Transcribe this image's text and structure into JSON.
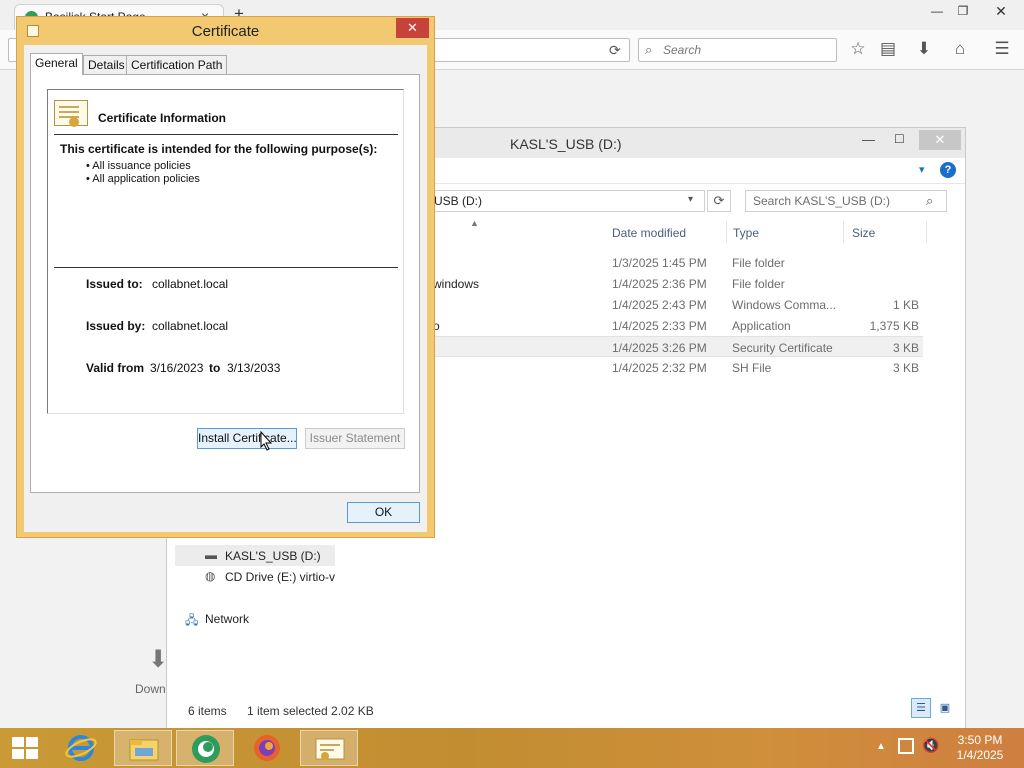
{
  "browser": {
    "tab_title": "Basilisk Start Page",
    "tab_close": "×",
    "new_tab": "+",
    "search_placeholder": "Search",
    "download_label": "Down"
  },
  "explorer": {
    "title": "KASL'S_USB (D:)",
    "address": "USB (D:)",
    "search_placeholder": "Search KASL'S_USB (D:)",
    "columns": {
      "date": "Date modified",
      "type": "Type",
      "size": "Size"
    },
    "files": [
      {
        "name": "",
        "date": "1/3/2025 1:45 PM",
        "type": "File folder",
        "size": ""
      },
      {
        "name": "windows",
        "date": "1/4/2025 2:36 PM",
        "type": "File folder",
        "size": ""
      },
      {
        "name": "",
        "date": "1/4/2025 2:43 PM",
        "type": "Windows Comma...",
        "size": "1 KB"
      },
      {
        "name": "o",
        "date": "1/4/2025 2:33 PM",
        "type": "Application",
        "size": "1,375 KB"
      },
      {
        "name": "",
        "date": "1/4/2025 3:26 PM",
        "type": "Security Certificate",
        "size": "3 KB"
      },
      {
        "name": "",
        "date": "1/4/2025 2:32 PM",
        "type": "SH File",
        "size": "3 KB"
      }
    ],
    "nav": {
      "usb": "KASL'S_USB (D:)",
      "cd": "CD Drive (E:) virtio-v",
      "network": "Network"
    },
    "status": {
      "items": "6 items",
      "selected": "1 item selected  2.02 KB"
    }
  },
  "cert": {
    "title": "Certificate",
    "tabs": [
      "General",
      "Details",
      "Certification Path"
    ],
    "info_heading": "Certificate Information",
    "purpose_heading": "This certificate is intended for the following purpose(s):",
    "purposes": [
      "• All issuance policies",
      "• All application policies"
    ],
    "issued_to_label": "Issued to:",
    "issued_to": "collabnet.local",
    "issued_by_label": "Issued by:",
    "issued_by": "collabnet.local",
    "valid_from_label": "Valid from",
    "valid_from": "3/16/2023",
    "to_label": "to",
    "valid_to": "3/13/2033",
    "install_button": "Install Certificate...",
    "issuer_button": "Issuer Statement",
    "ok_button": "OK"
  },
  "taskbar": {
    "time": "3:50 PM",
    "date": "1/4/2025"
  },
  "colors": {
    "dialog_frame": "#f2c971",
    "taskbar": "#c99a36",
    "close_red": "#c7423a",
    "explorer_accent": "#1a6fc8"
  },
  "icons": [
    "search-icon",
    "reload-icon",
    "star-icon",
    "reading-list-icon",
    "download-icon",
    "home-icon",
    "menu-icon",
    "help-icon",
    "certificate-icon",
    "drive-icon",
    "cd-drive-icon",
    "network-icon",
    "windows-logo-icon",
    "ie-icon",
    "file-explorer-icon",
    "basilisk-icon",
    "firefox-icon",
    "certificate-task-icon",
    "network-tray-icon",
    "volume-icon"
  ]
}
